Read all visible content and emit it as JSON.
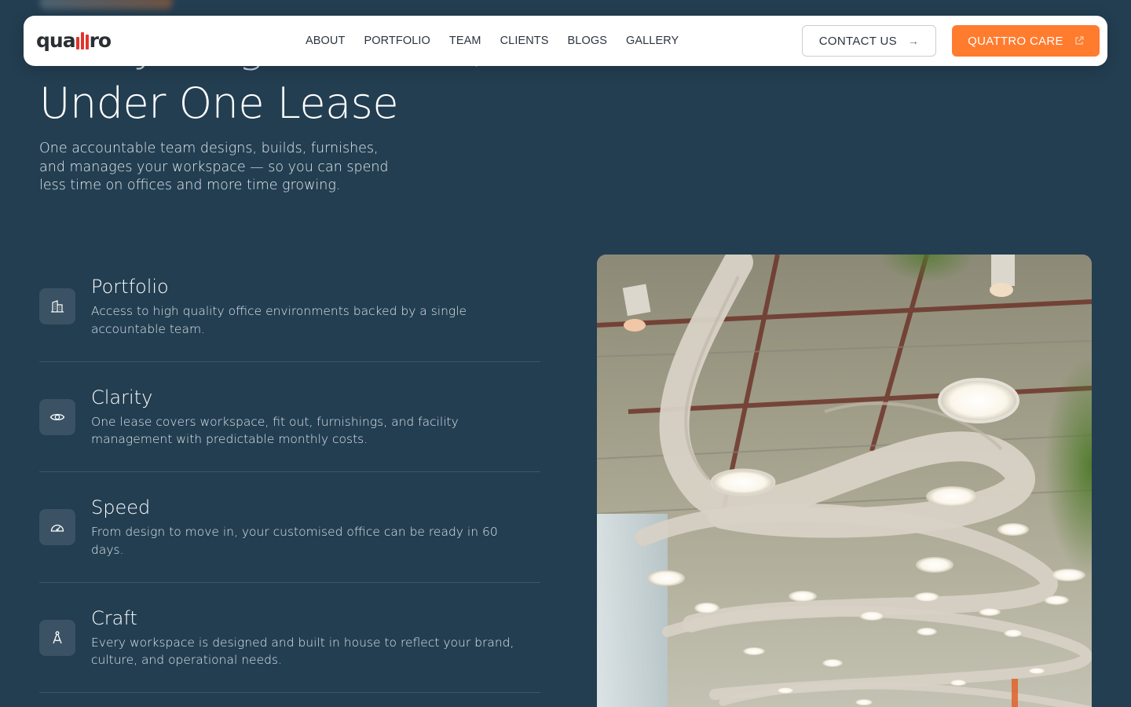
{
  "hero": {
    "title_line1": "Everything You Need,",
    "title_line2": "Under One Lease",
    "description": "One accountable team designs, builds, furnishes, and manages your workspace — so you can spend less time on offices and more time growing."
  },
  "navbar": {
    "logo_text_left": "qua",
    "logo_text_right": "ro",
    "links": [
      "ABOUT",
      "PORTFOLIO",
      "TEAM",
      "CLIENTS",
      "BLOGS",
      "GALLERY"
    ],
    "contact_label": "CONTACT US",
    "care_label": "QUATTRO CARE"
  },
  "features": [
    {
      "title": "Portfolio",
      "description": "Access to high quality office environments backed by a single accountable team.",
      "icon": "building-icon"
    },
    {
      "title": "Clarity",
      "description": "One lease covers workspace, fit out, furnishings, and facility management with predictable monthly costs.",
      "icon": "eye-icon"
    },
    {
      "title": "Speed",
      "description": "From design to move in, your customised office can be ready in 60 days.",
      "icon": "speedometer-icon"
    },
    {
      "title": "Craft",
      "description": "Every workspace is designed and built in house to reflect your brand, culture, and operational needs.",
      "icon": "drafting-compass-icon"
    }
  ],
  "colors": {
    "background": "#233e51",
    "accent_orange": "#ff7b2e",
    "logo_red": "#e2342d",
    "icon_tile": "#3a5263"
  }
}
